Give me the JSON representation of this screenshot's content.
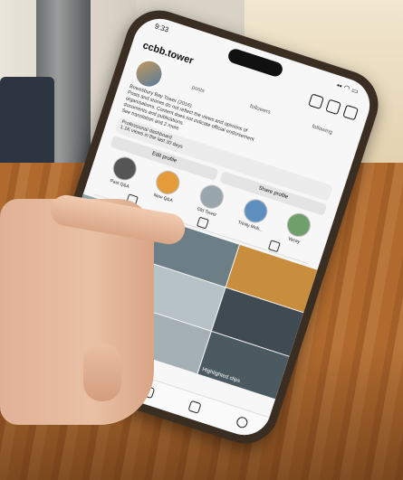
{
  "phone": {
    "status": {
      "time": "9:33",
      "indicators": "▪▪ ◠ ▭"
    },
    "profile": {
      "username": "ccbb.tower",
      "stats": [
        "posts",
        "followers",
        "following"
      ],
      "bio_lines": [
        "Bowesbury Bay Tower (2016)",
        "Posts and stories do not reflect the views and opinions of",
        "organisations. Content does not indicate official endorsement",
        "documents and publications.",
        "See translation and 2 more"
      ],
      "dashboard": {
        "title": "Professional dashboard",
        "subtitle": "1.1K views in the last 30 days"
      },
      "buttons": {
        "edit": "Edit profile",
        "share": "Share profile"
      },
      "highlights": [
        "Past Q&A",
        "New Q&A",
        "Old Tower",
        "Trinity Mob...",
        "Vacay"
      ]
    },
    "grid_label": "Highlighted clips"
  },
  "colors": {
    "table": "#a35f28",
    "frame": "#3a2e22",
    "screen": "#f7f7f7"
  }
}
